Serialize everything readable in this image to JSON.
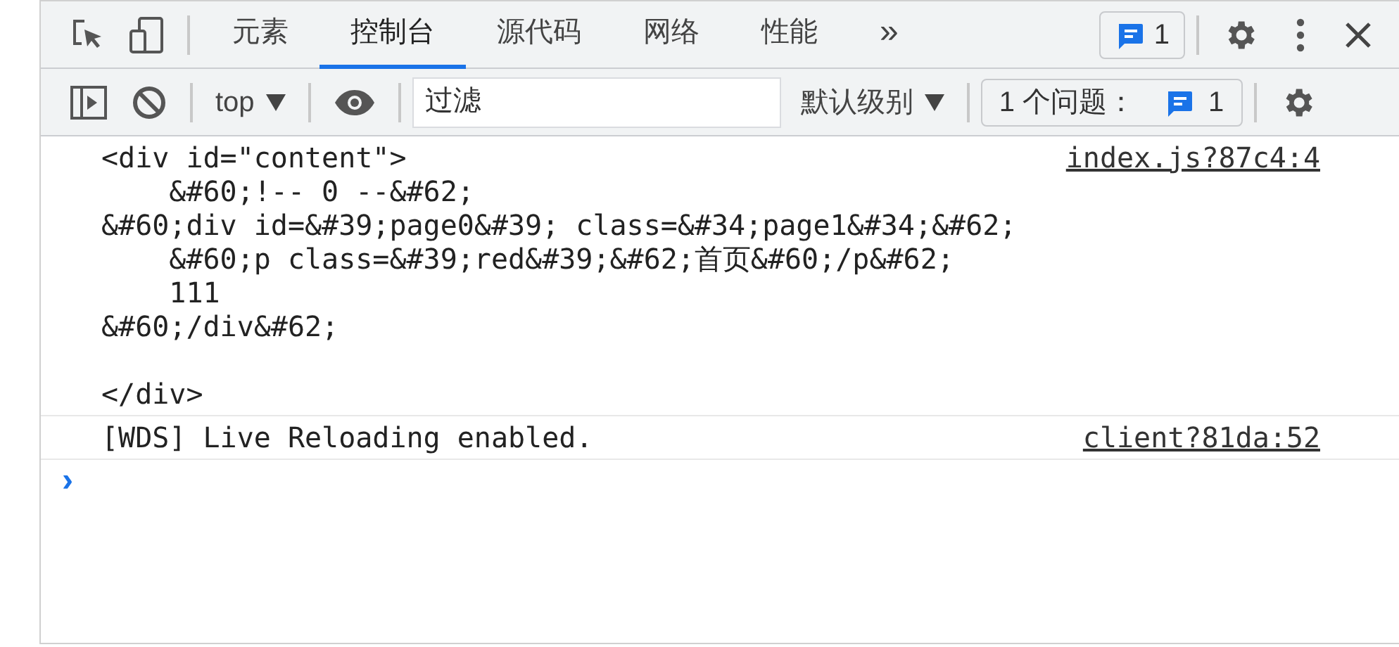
{
  "main_toolbar": {
    "tabs": [
      {
        "label": "元素",
        "selected": false
      },
      {
        "label": "控制台",
        "selected": true
      },
      {
        "label": "源代码",
        "selected": false
      },
      {
        "label": "网络",
        "selected": false
      },
      {
        "label": "性能",
        "selected": false
      }
    ],
    "more_tabs": "»",
    "issues_badge": "1"
  },
  "console_toolbar": {
    "context": "top",
    "filter": {
      "placeholder": "过滤"
    },
    "levels": "默认级别",
    "issues_label": "1 个问题：",
    "issues_count": "1"
  },
  "messages": [
    {
      "text": "<div id=\"content\">\n    &#60;!-- 0 --&#62;\n&#60;div id=&#39;page0&#39; class=&#34;page1&#34;&#62;\n    &#60;p class=&#39;red&#39;&#62;首页&#60;/p&#62;\n    111\n&#60;/div&#62;\n\n</div>",
      "source": "index.js?87c4:4"
    },
    {
      "text": "[WDS] Live Reloading enabled.",
      "source": "client?81da:52"
    }
  ],
  "prompt": "›"
}
